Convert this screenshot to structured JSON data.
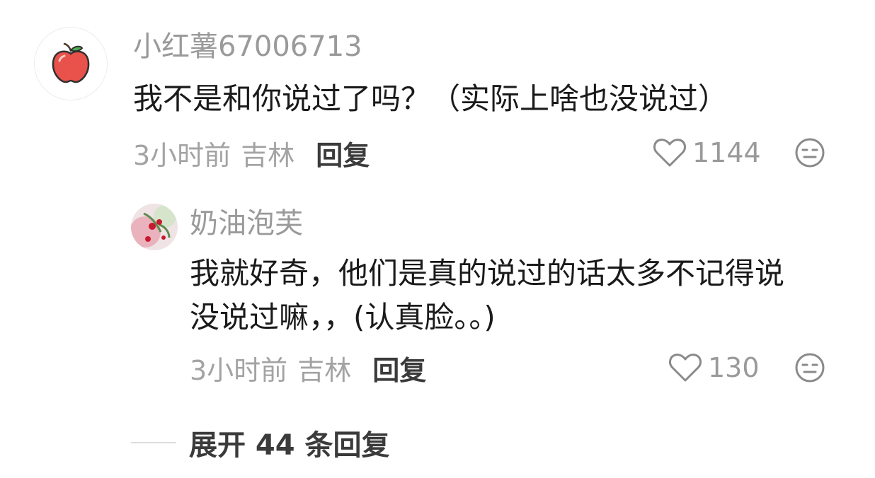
{
  "comment": {
    "username": "小红薯67006713",
    "text": "我不是和你说过了吗？（实际上啥也没说过）",
    "time": "3小时前",
    "location": "吉林",
    "reply_label": "回复",
    "likes": "1144",
    "avatar_icon": "apple-icon",
    "reaction_icon": "neutral-face-icon"
  },
  "reply": {
    "username": "奶油泡芙",
    "text_lines": [
      "我就好奇，他们是真的说过的话太多不记得说",
      "没说过嘛，，(认真脸。。)"
    ],
    "time": "3小时前",
    "location": "吉林",
    "reply_label": "回复",
    "likes": "130",
    "reaction_icon": "neutral-face-icon"
  },
  "expand_label": "展开 44 条回复",
  "colors": {
    "muted_text": "#9a9a9a",
    "body_text": "#1a1a1a",
    "action_text": "#3b3b3b",
    "apple_red": "#e8524a"
  }
}
